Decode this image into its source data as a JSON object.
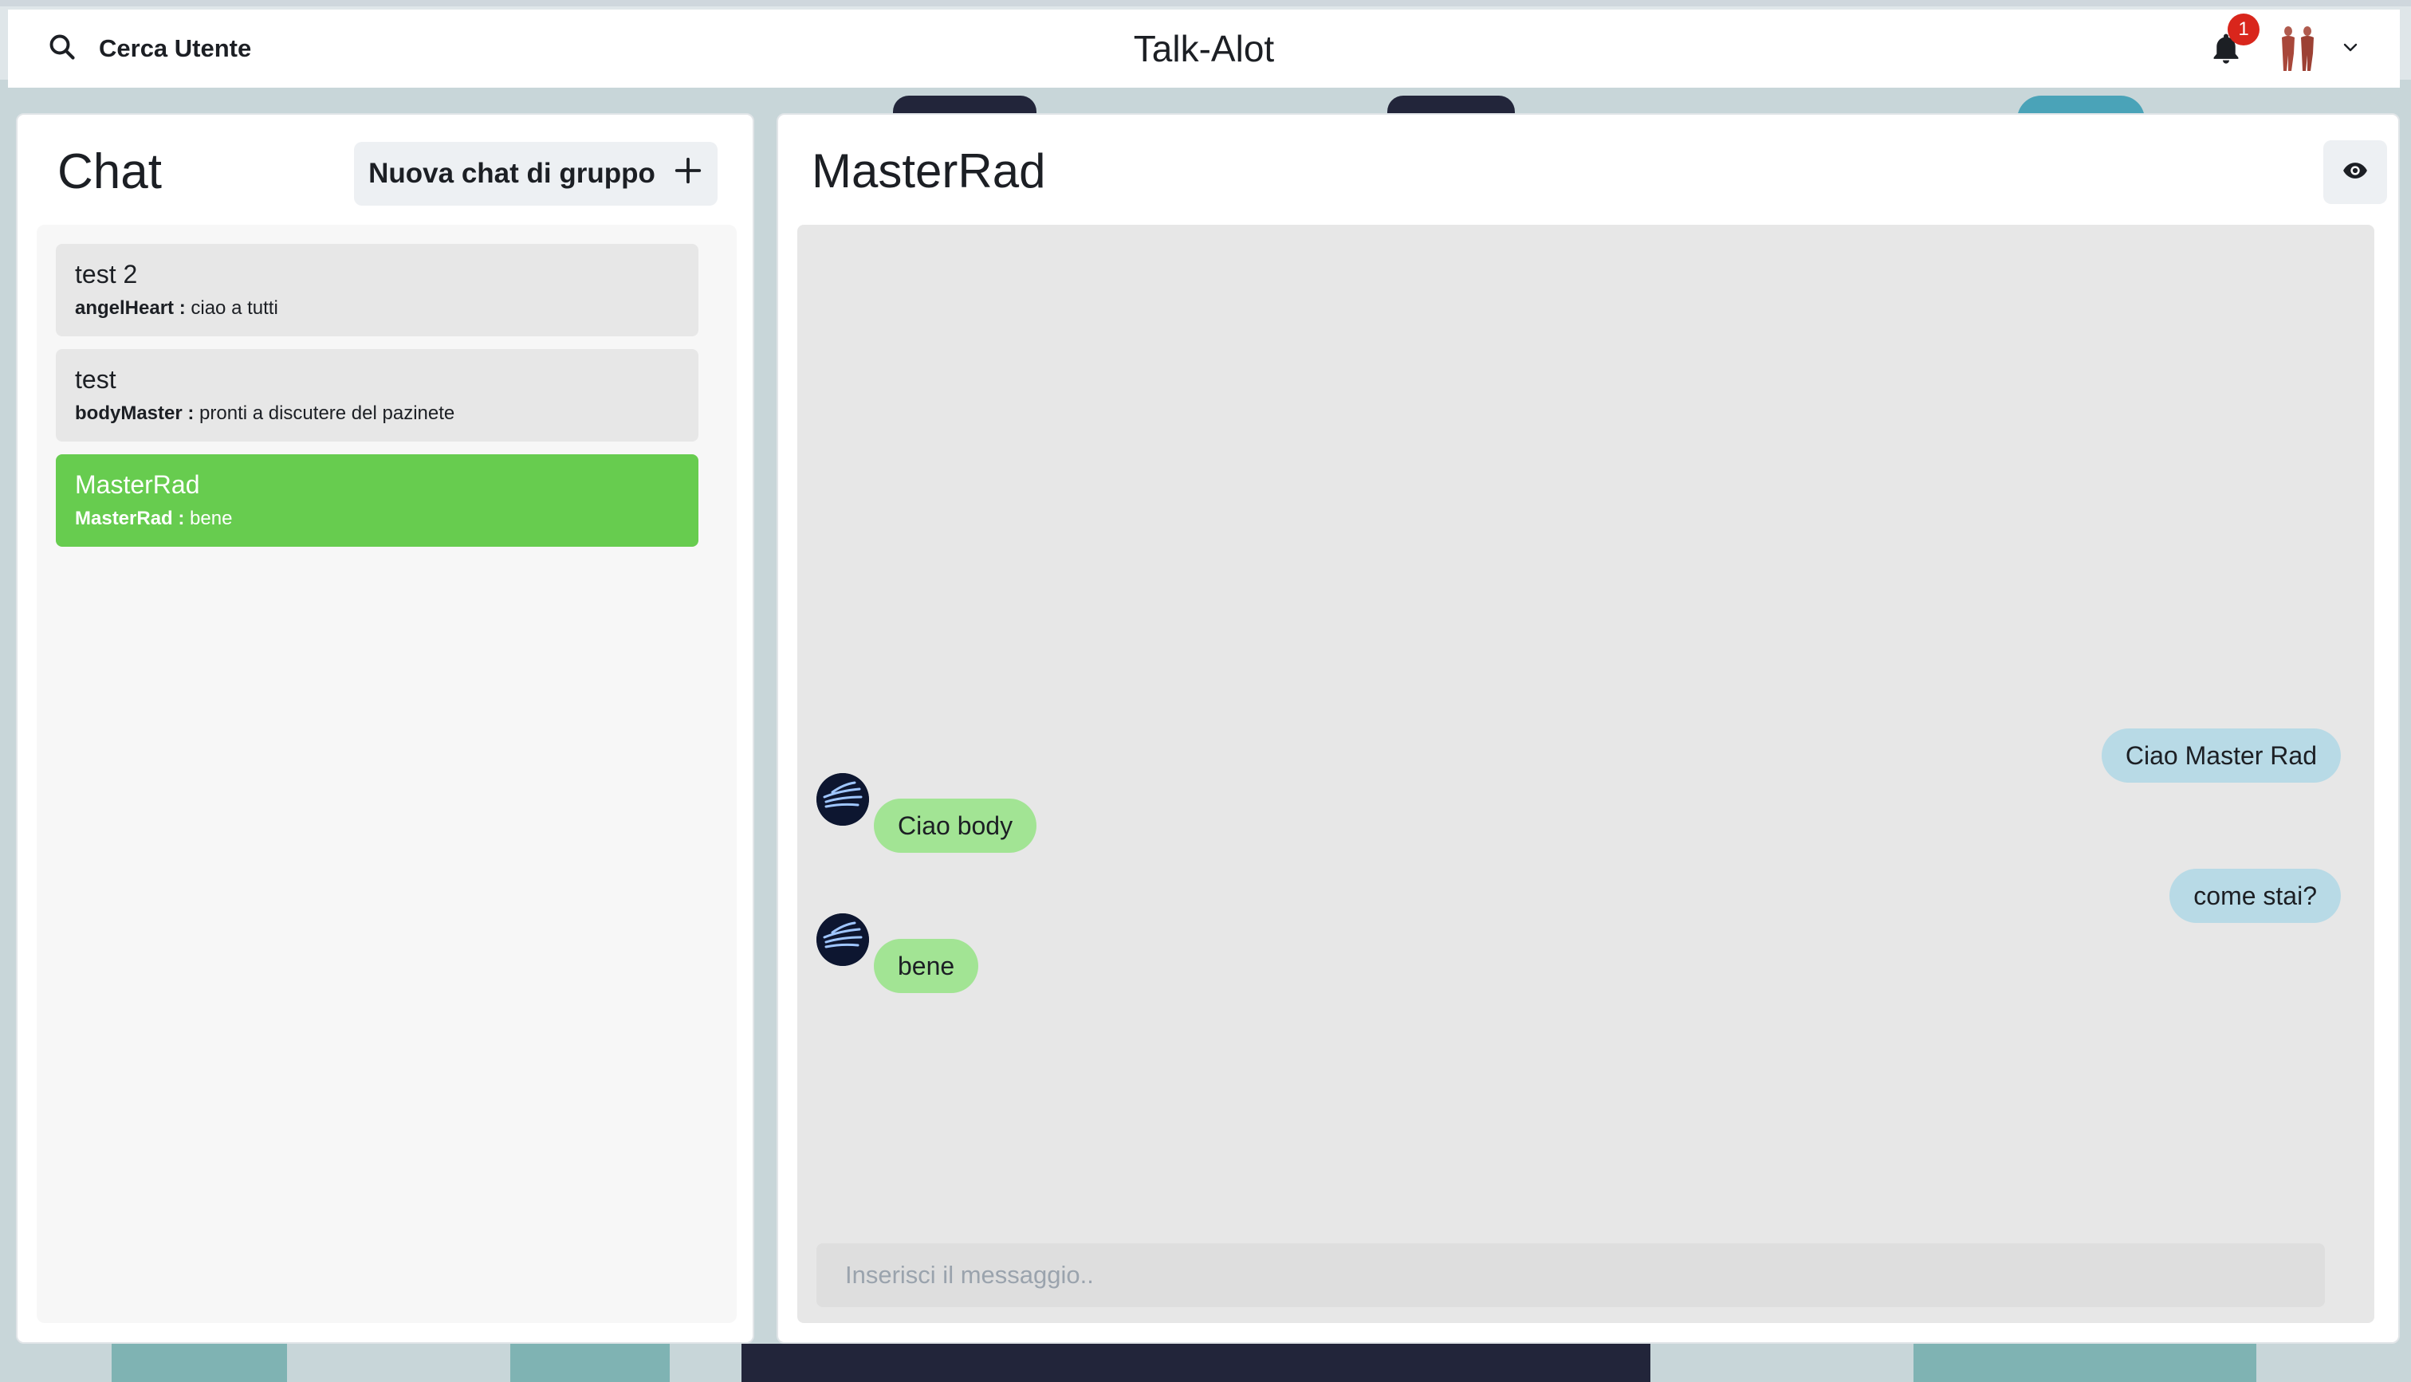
{
  "header": {
    "search_label": "Cerca Utente",
    "app_title": "Talk-Alot",
    "notification_count": "1"
  },
  "sidebar": {
    "heading": "Chat",
    "new_group_label": "Nuova chat di gruppo",
    "chats": [
      {
        "name": "test 2",
        "sender": "angelHeart :",
        "message": "ciao a tutti",
        "active": false
      },
      {
        "name": "test",
        "sender": "bodyMaster :",
        "message": "pronti a discutere del pazinete",
        "active": false
      },
      {
        "name": "MasterRad",
        "sender": "MasterRad :",
        "message": "bene",
        "active": true
      }
    ]
  },
  "conversation": {
    "title": "MasterRad",
    "messages": [
      {
        "text": "Ciao Master Rad",
        "direction": "out"
      },
      {
        "text": "Ciao body",
        "direction": "in"
      },
      {
        "text": "come stai?",
        "direction": "out"
      },
      {
        "text": "bene",
        "direction": "in"
      }
    ],
    "input_placeholder": "Inserisci il messaggio.."
  },
  "colors": {
    "active_chat": "#67cc4f",
    "outgoing_bubble": "#b8dae6",
    "incoming_bubble": "#a2e494",
    "badge": "#d9261c"
  }
}
